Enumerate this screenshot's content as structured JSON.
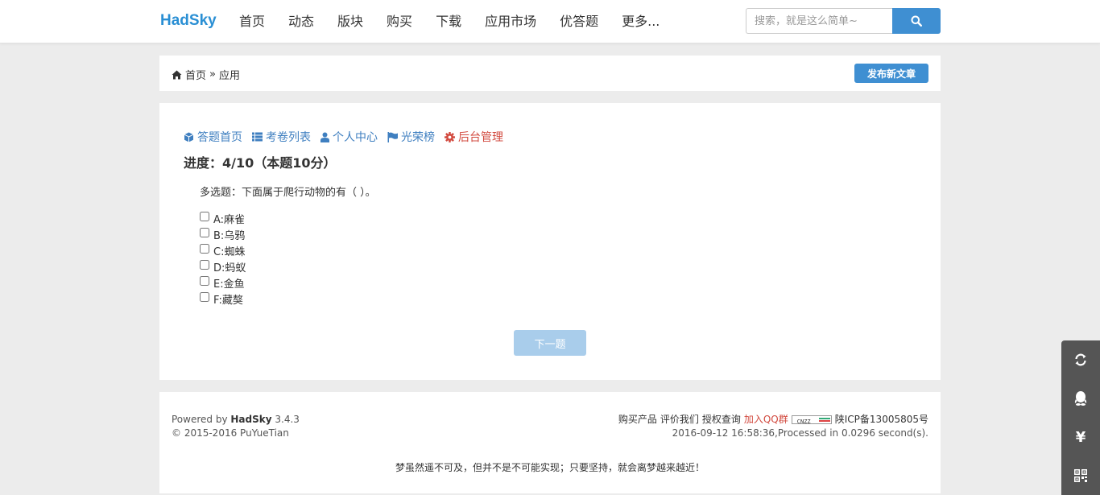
{
  "header": {
    "brand": "HadSky",
    "nav": [
      "首页",
      "动态",
      "版块",
      "购买",
      "下载",
      "应用市场",
      "优答题",
      "更多..."
    ],
    "search": {
      "placeholder": "搜索，就是这么简单~",
      "icon": "search-icon"
    }
  },
  "breadcrumb": {
    "home_icon": "home-icon",
    "home": "首页",
    "separator": "»",
    "current": "应用",
    "publish_label": "发布新文章"
  },
  "subnav": [
    {
      "label": "答题首页",
      "icon": "cube-icon"
    },
    {
      "label": "考卷列表",
      "icon": "list-icon"
    },
    {
      "label": "个人中心",
      "icon": "user-icon"
    },
    {
      "label": "光荣榜",
      "icon": "flag-icon"
    },
    {
      "label": "后台管理",
      "icon": "gear-icon"
    }
  ],
  "quiz": {
    "progress": "进度：4/10（本题10分）",
    "question": "多选题：下面属于爬行动物的有（     ）。",
    "options": [
      "A:麻雀",
      "B:乌鸦",
      "C:蜘蛛",
      "D:蚂蚁",
      "E:金鱼",
      "F:藏獒"
    ],
    "next_label": "下一题"
  },
  "footer": {
    "powered_prefix": "Powered by ",
    "powered_name": "HadSky",
    "powered_version": " 3.4.3",
    "copyright": "© 2015-2016 PuYueTian",
    "links": [
      "购买产品",
      "评价我们",
      "授权查询"
    ],
    "qq_group": "加入QQ群",
    "cnzz_badge": "CNZZ",
    "icp": "陕ICP备13005805号",
    "timestamp": "2016-09-12 16:58:36,Processed in 0.0296 second(s).",
    "motto": "梦虽然遥不可及，但并不是不可能实现；只要坚持，就会离梦越来越近！"
  },
  "sidetool": {
    "items": [
      "refresh-icon",
      "qq-icon",
      "yuan-icon",
      "qrcode-icon"
    ],
    "yuan_symbol": "¥"
  },
  "colors": {
    "brand": "#2a8fd4",
    "primary_button": "#3f8fd2",
    "link": "#3f7fc0",
    "danger": "#d24a3f",
    "background": "#ececec"
  }
}
